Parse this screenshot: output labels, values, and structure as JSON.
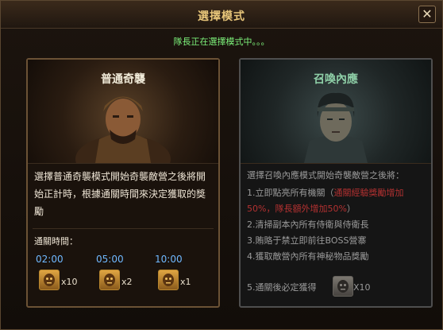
{
  "dialog": {
    "title": "選擇模式",
    "close_label": "✕",
    "status": "隊長正在選擇模式中。。。"
  },
  "left_panel": {
    "title": "普通奇襲",
    "description": "選擇普通奇襲模式開始奇襲敵營之後將開始正計時，根據通關時間來決定獲取的獎勵",
    "time_label": "通關時間：",
    "rewards": [
      {
        "time": "02:00",
        "qty": "x10"
      },
      {
        "time": "05:00",
        "qty": "x2"
      },
      {
        "time": "10:00",
        "qty": "x1"
      }
    ]
  },
  "right_panel": {
    "title": "召喚內應",
    "description": "選擇召喚內應模式開始奇襲敵營之後將：",
    "items": [
      {
        "prefix": "1.立即點亮所有機關（",
        "red": "通關經驗獎勵增加50%，隊長額外增加50%",
        "suffix": "）"
      },
      {
        "text": "2.清掃副本內所有侍衛與侍衛長"
      },
      {
        "text": "3.賄賂于禁立即前往BOSS營寨"
      },
      {
        "text": "4.獲取敵營內所有神秘物品獎勵"
      }
    ],
    "last_item": {
      "text": "5.通關後必定獲得",
      "qty": "X10"
    }
  },
  "colors": {
    "accent_gold": "#e8c67a",
    "status_green": "#7cf07a",
    "time_blue": "#6fb8ff",
    "highlight_red": "#b33131"
  },
  "icons": [
    "close-icon",
    "mask-token-icon"
  ]
}
